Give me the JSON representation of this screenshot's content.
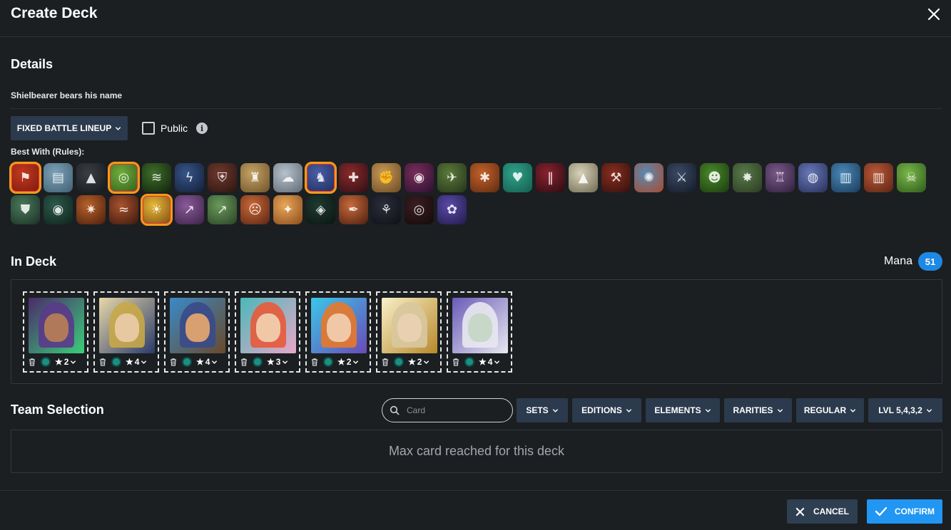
{
  "dialog": {
    "title": "Create Deck"
  },
  "details": {
    "heading": "Details",
    "deck_name": "Shielbearer bears his name",
    "lineup_button": "FIXED BATTLE LINEUP",
    "public_label": "Public",
    "best_with_label": "Best With (Rules):"
  },
  "rules": [
    {
      "icon": "flag-rule-icon",
      "colors": [
        "#c23a1e",
        "#7a1810"
      ],
      "glyph": "⚑",
      "selected": true
    },
    {
      "icon": "cards-swap-rule-icon",
      "colors": [
        "#7fa2b8",
        "#3e5f73"
      ],
      "glyph": "▤",
      "selected": false
    },
    {
      "icon": "hooded-figure-rule-icon",
      "colors": [
        "#3b3f44",
        "#15181b"
      ],
      "glyph": "▲",
      "selected": false
    },
    {
      "icon": "target-arrow-rule-icon",
      "colors": [
        "#6fae3a",
        "#2f5c1c"
      ],
      "glyph": "◎",
      "selected": true
    },
    {
      "icon": "thorns-rule-icon",
      "colors": [
        "#3f6e2a",
        "#10220c"
      ],
      "glyph": "≋",
      "selected": false
    },
    {
      "icon": "lightning-rule-icon",
      "colors": [
        "#37558a",
        "#141e36"
      ],
      "glyph": "ϟ",
      "selected": false
    },
    {
      "icon": "shield-rule-icon",
      "colors": [
        "#6f3a2e",
        "#2a1410"
      ],
      "glyph": "⛨",
      "selected": false
    },
    {
      "icon": "trophy-rule-icon",
      "colors": [
        "#c6a466",
        "#6e5228"
      ],
      "glyph": "♜",
      "selected": false
    },
    {
      "icon": "cloud-rule-icon",
      "colors": [
        "#b8c2cc",
        "#5f6a74"
      ],
      "glyph": "☁",
      "selected": false
    },
    {
      "icon": "horned-helmet-rule-icon",
      "colors": [
        "#4b5fa8",
        "#1e2a5a"
      ],
      "glyph": "♞",
      "selected": true
    },
    {
      "icon": "bandage-rule-icon",
      "colors": [
        "#8a2a2a",
        "#2e0f14"
      ],
      "glyph": "✚",
      "selected": false
    },
    {
      "icon": "fist-rule-icon",
      "colors": [
        "#c89a5a",
        "#6a4a22"
      ],
      "glyph": "✊",
      "selected": false
    },
    {
      "icon": "eye-arrow-rule-icon",
      "colors": [
        "#7a2e5a",
        "#2a1030"
      ],
      "glyph": "◉",
      "selected": false
    },
    {
      "icon": "bird-rule-icon",
      "colors": [
        "#5c7a3a",
        "#23331a"
      ],
      "glyph": "✈",
      "selected": false
    },
    {
      "icon": "muscle-rule-icon",
      "colors": [
        "#c4622a",
        "#5e2a10"
      ],
      "glyph": "✱",
      "selected": false
    },
    {
      "icon": "heart-up-rule-icon",
      "colors": [
        "#2fa38a",
        "#145c4e"
      ],
      "glyph": "♥",
      "selected": false
    },
    {
      "icon": "bars-rule-icon",
      "colors": [
        "#8a2230",
        "#2a0c10"
      ],
      "glyph": "‖",
      "selected": false
    },
    {
      "icon": "mountain-rule-icon",
      "colors": [
        "#d8d2b8",
        "#6e6a52"
      ],
      "glyph": "▲",
      "selected": false
    },
    {
      "icon": "axe-rule-icon",
      "colors": [
        "#8a2e20",
        "#30100c"
      ],
      "glyph": "⚒",
      "selected": false
    },
    {
      "icon": "color-wheel-rule-icon",
      "colors": [
        "#5a8ab4",
        "#a84a2e"
      ],
      "glyph": "✺",
      "selected": false
    },
    {
      "icon": "sword-circle-rule-icon",
      "colors": [
        "#3a4a66",
        "#141a26"
      ],
      "glyph": "⚔",
      "selected": false
    },
    {
      "icon": "goblin-rule-icon",
      "colors": [
        "#4a8a2a",
        "#1a3a10"
      ],
      "glyph": "☻",
      "selected": false
    },
    {
      "icon": "burst-rule-icon",
      "colors": [
        "#5a7a4a",
        "#2a3a22"
      ],
      "glyph": "✸",
      "selected": false
    },
    {
      "icon": "tower-rule-icon",
      "colors": [
        "#7a5a8a",
        "#2e1e3a"
      ],
      "glyph": "♖",
      "selected": false
    },
    {
      "icon": "crystal-ball-rule-icon",
      "colors": [
        "#6a7ab8",
        "#262e5a"
      ],
      "glyph": "◍",
      "selected": false
    },
    {
      "icon": "card-stack-blue-rule-icon",
      "colors": [
        "#4a8ab8",
        "#1a3a5a"
      ],
      "glyph": "▥",
      "selected": false
    },
    {
      "icon": "card-stack-red-rule-icon",
      "colors": [
        "#b85a3a",
        "#5a2212"
      ],
      "glyph": "▥",
      "selected": false
    },
    {
      "icon": "skull-rule-icon",
      "colors": [
        "#7ab84a",
        "#2e5a1a"
      ],
      "glyph": "☠",
      "selected": false
    },
    {
      "icon": "shield-bash-rule-icon",
      "colors": [
        "#4a7a5a",
        "#1a3026"
      ],
      "glyph": "⛊",
      "selected": false
    },
    {
      "icon": "eye-rule-icon",
      "colors": [
        "#2e5a4a",
        "#0e221c"
      ],
      "glyph": "◉",
      "selected": false
    },
    {
      "icon": "explosion-rule-icon",
      "colors": [
        "#b8622a",
        "#4a1e0c"
      ],
      "glyph": "✷",
      "selected": false
    },
    {
      "icon": "claws-rule-icon",
      "colors": [
        "#a8522e",
        "#3a180c"
      ],
      "glyph": "≈",
      "selected": false
    },
    {
      "icon": "sun-burst-rule-icon",
      "colors": [
        "#e8b83a",
        "#7a4a10"
      ],
      "glyph": "☀",
      "selected": true
    },
    {
      "icon": "lance-rule-icon",
      "colors": [
        "#8a5a9a",
        "#3a2246"
      ],
      "glyph": "↗",
      "selected": false
    },
    {
      "icon": "spear-rule-icon",
      "colors": [
        "#6a9a5a",
        "#2a4226"
      ],
      "glyph": "↗",
      "selected": false
    },
    {
      "icon": "brute-rule-icon",
      "colors": [
        "#c86a3a",
        "#5a2410"
      ],
      "glyph": "☹",
      "selected": false
    },
    {
      "icon": "sparkle-rule-icon",
      "colors": [
        "#e8a85a",
        "#8a4a1a"
      ],
      "glyph": "✦",
      "selected": false
    },
    {
      "icon": "diamond-rule-icon",
      "colors": [
        "#1e3a30",
        "#0a1410"
      ],
      "glyph": "◈",
      "selected": false
    },
    {
      "icon": "feather-rule-icon",
      "colors": [
        "#c86a3a",
        "#4a1e10"
      ],
      "glyph": "✒",
      "selected": false
    },
    {
      "icon": "monster-rule-icon",
      "colors": [
        "#2a2e3a",
        "#0e1016"
      ],
      "glyph": "⚘",
      "selected": false
    },
    {
      "icon": "bullseye-rule-icon",
      "colors": [
        "#3a1e22",
        "#140a0c"
      ],
      "glyph": "◎",
      "selected": false
    },
    {
      "icon": "flower-burst-rule-icon",
      "colors": [
        "#5a4aa8",
        "#221a4a"
      ],
      "glyph": "✿",
      "selected": false
    }
  ],
  "in_deck": {
    "heading": "In Deck",
    "mana_label": "Mana",
    "mana_value": "51",
    "cards": [
      {
        "name": "hooded-summoner-card",
        "level": "2",
        "bg": [
          "#4a2a6a",
          "#3ad07a"
        ],
        "skin": "#b07a5a",
        "hood": "#5a3a8a"
      },
      {
        "name": "armored-knight-card",
        "level": "4",
        "bg": [
          "#e8d8a8",
          "#2a3a6a"
        ],
        "skin": "#e8c8a0",
        "hood": "#c8a848"
      },
      {
        "name": "pirate-captain-card",
        "level": "4",
        "bg": [
          "#3a8ac8",
          "#6a4a2a"
        ],
        "skin": "#d8a070",
        "hood": "#3a4a8a"
      },
      {
        "name": "red-haired-mage-card",
        "level": "3",
        "bg": [
          "#4ab8b8",
          "#e8a8c8"
        ],
        "skin": "#f0c8a8",
        "hood": "#e85a3a"
      },
      {
        "name": "ice-sorceress-card",
        "level": "2",
        "bg": [
          "#3ac8e8",
          "#6a4ab8"
        ],
        "skin": "#f0c8a8",
        "hood": "#e8782a"
      },
      {
        "name": "old-sage-card",
        "level": "2",
        "bg": [
          "#f8f0c8",
          "#b8882a"
        ],
        "skin": "#e8d0b0",
        "hood": "#d8c8a0"
      },
      {
        "name": "ghost-monk-card",
        "level": "4",
        "bg": [
          "#6a5ab8",
          "#e8e8f0"
        ],
        "skin": "#c8d8c8",
        "hood": "#e8e8f0"
      }
    ]
  },
  "team_selection": {
    "heading": "Team Selection",
    "search_placeholder": "Card",
    "filters": [
      "SETS",
      "EDITIONS",
      "ELEMENTS",
      "RARITIES",
      "REGULAR",
      "LVL 5,4,3,2"
    ],
    "empty_message": "Max card reached for this deck"
  },
  "footer": {
    "cancel_label": "CANCEL",
    "confirm_label": "CONFIRM"
  },
  "colors": {
    "accent": "#2196f3",
    "dark_button": "#2b3a4d",
    "background": "#1b1f22"
  }
}
